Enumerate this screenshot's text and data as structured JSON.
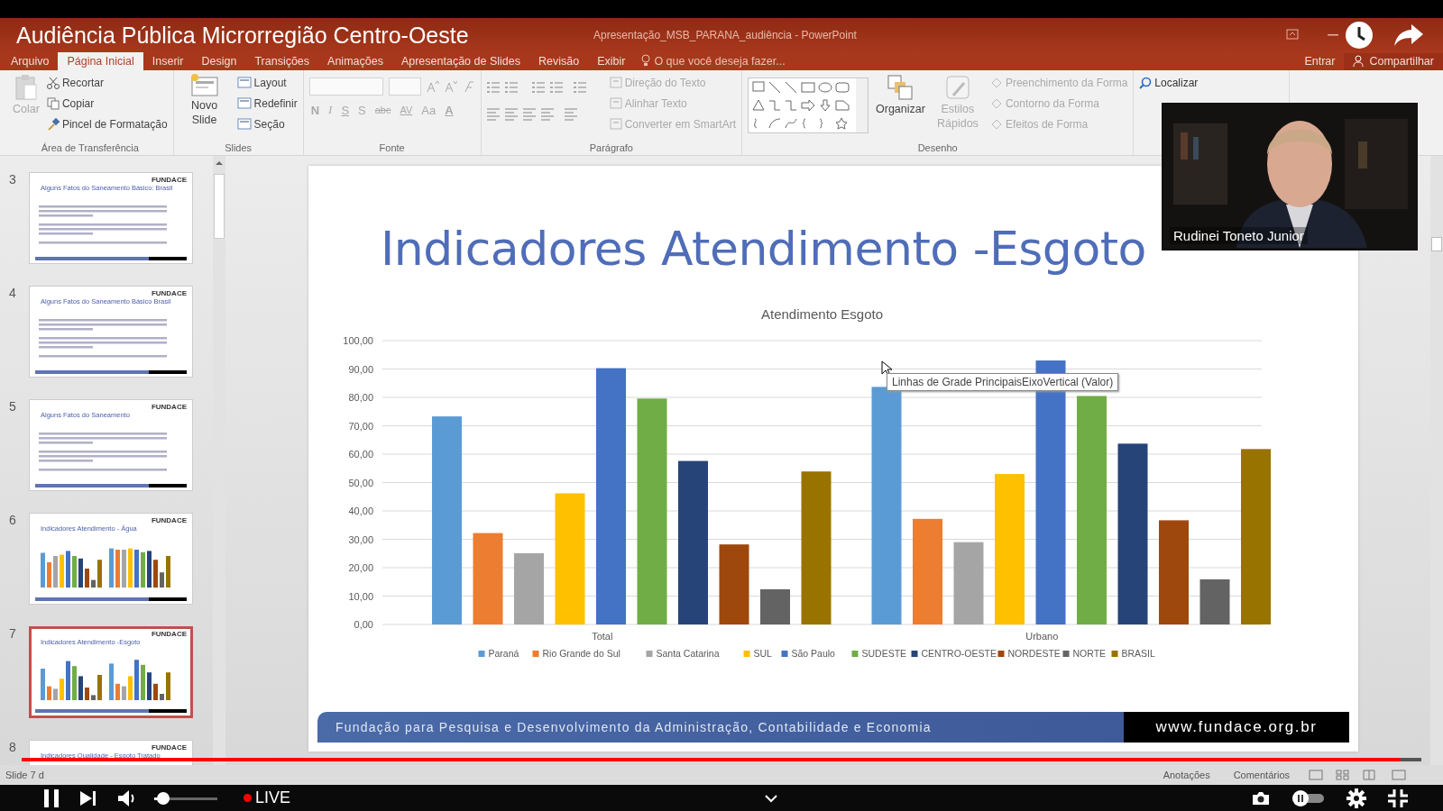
{
  "overlay": {
    "title": "Audiência Pública Microrregião Centro-Oeste"
  },
  "window": {
    "title": "Apresentação_MSB_PARANA_audiência - PowerPoint"
  },
  "menu_tabs": [
    {
      "label": "Arquivo",
      "selected": false
    },
    {
      "label": "Página Inicial",
      "selected": true
    },
    {
      "label": "Inserir",
      "selected": false
    },
    {
      "label": "Design",
      "selected": false
    },
    {
      "label": "Transições",
      "selected": false
    },
    {
      "label": "Animações",
      "selected": false
    },
    {
      "label": "Apresentação de Slides",
      "selected": false
    },
    {
      "label": "Revisão",
      "selected": false
    },
    {
      "label": "Exibir",
      "selected": false
    }
  ],
  "search_hint": "O que você deseja fazer...",
  "account": {
    "sign_in": "Entrar",
    "share": "Compartilhar"
  },
  "ribbon": {
    "clipboard": {
      "label": "Área de Transferência",
      "paste": {
        "label": "Colar",
        "disabled": true
      },
      "items": [
        {
          "label": "Recortar",
          "disabled": false
        },
        {
          "label": "Copiar",
          "disabled": false
        },
        {
          "label": "Pincel de Formatação",
          "disabled": false
        }
      ]
    },
    "slides": {
      "label": "Slides",
      "new_slide": "Novo Slide",
      "items": [
        {
          "label": "Layout",
          "disabled": false
        },
        {
          "label": "Redefinir",
          "disabled": false
        },
        {
          "label": "Seção",
          "disabled": false
        }
      ]
    },
    "font": {
      "label": "Fonte",
      "buttons": [
        "N",
        "I",
        "S",
        "S",
        "abc",
        "AV",
        "Aa",
        "A"
      ]
    },
    "paragraph": {
      "label": "Parágrafo",
      "items": [
        {
          "label": "Direção do Texto",
          "disabled": true
        },
        {
          "label": "Alinhar Texto",
          "disabled": true
        },
        {
          "label": "Converter em SmartArt",
          "disabled": true
        }
      ]
    },
    "drawing": {
      "label": "Desenho",
      "arrange": "Organizar",
      "quick_styles": {
        "label": "Estilos Rápidos",
        "disabled": true
      },
      "items": [
        {
          "label": "Preenchimento da Forma",
          "disabled": true
        },
        {
          "label": "Contorno da Forma",
          "disabled": true
        },
        {
          "label": "Efeitos de Forma",
          "disabled": true
        }
      ]
    },
    "editing": {
      "find": "Localizar"
    }
  },
  "thumbnails": [
    {
      "number": "3",
      "title": "Alguns Fatos do Saneamento Básico: Brasil",
      "logo": "FUNDACE",
      "kind": "text",
      "selected": false
    },
    {
      "number": "4",
      "title": "Alguns Fatos do Saneamento Básico Brasil",
      "logo": "FUNDACE",
      "kind": "text",
      "selected": false
    },
    {
      "number": "5",
      "title": "Alguns Fatos do Saneamento",
      "logo": "FUNDACE",
      "kind": "text",
      "selected": false
    },
    {
      "number": "6",
      "title": "Indicadores Atendimento - Água",
      "logo": "FUNDACE",
      "kind": "chart",
      "selected": false
    },
    {
      "number": "7",
      "title": "Indicadores Atendimento -Esgoto",
      "logo": "FUNDACE",
      "kind": "chart",
      "selected": true
    },
    {
      "number": "8",
      "title": "Indicadores Qualidade - Esgoto Tratado",
      "logo": "FUNDACE",
      "kind": "partial",
      "selected": false
    }
  ],
  "slide": {
    "title": "Indicadores Atendimento -Esgoto",
    "chart_data": {
      "type": "bar",
      "title": "Atendimento Esgoto",
      "categories": [
        "Total",
        "Urbano"
      ],
      "ylim": [
        0,
        100
      ],
      "grid": true,
      "legend": true,
      "yticks": [
        {
          "value": 0,
          "label": "0,00"
        },
        {
          "value": 10,
          "label": "10,00"
        },
        {
          "value": 20,
          "label": "20,00"
        },
        {
          "value": 30,
          "label": "30,00"
        },
        {
          "value": 40,
          "label": "40,00"
        },
        {
          "value": 50,
          "label": "50,00"
        },
        {
          "value": 60,
          "label": "60,00"
        },
        {
          "value": 70,
          "label": "70,00"
        },
        {
          "value": 80,
          "label": "80,00"
        },
        {
          "value": 90,
          "label": "90,00"
        },
        {
          "value": 100,
          "label": "100,00"
        }
      ],
      "series": [
        {
          "name": "Paraná",
          "color": "#5b9bd5",
          "values": [
            73.3,
            83.7
          ]
        },
        {
          "name": "Rio Grande do Sul",
          "color": "#ed7d31",
          "values": [
            32.2,
            37.2
          ]
        },
        {
          "name": "Santa Catarina",
          "color": "#a5a5a5",
          "values": [
            25.1,
            29.0
          ]
        },
        {
          "name": "SUL",
          "color": "#ffc000",
          "values": [
            46.2,
            53.0
          ]
        },
        {
          "name": "São Paulo",
          "color": "#4472c4",
          "values": [
            90.3,
            93.0
          ]
        },
        {
          "name": "SUDESTE",
          "color": "#70ad47",
          "values": [
            79.6,
            80.5
          ]
        },
        {
          "name": "CENTRO-OESTE",
          "color": "#264478",
          "values": [
            57.6,
            63.7
          ]
        },
        {
          "name": "NORDESTE",
          "color": "#9e480e",
          "values": [
            28.2,
            36.7
          ]
        },
        {
          "name": "NORTE",
          "color": "#636363",
          "values": [
            12.4,
            15.9
          ]
        },
        {
          "name": "BRASIL",
          "color": "#997300",
          "values": [
            53.9,
            61.8
          ]
        }
      ]
    },
    "tooltip": "Linhas de Grade PrincipaisEixoVertical (Valor)",
    "footer": {
      "text": "Fundação para Pesquisa e Desenvolvimento da Administração, Contabilidade e Economia",
      "url": "www.fundace.org.br"
    }
  },
  "webcam": {
    "name": "Rudinei Toneto Junior"
  },
  "status_bar": {
    "slide_info": "Slide 7 d",
    "notes": "Anotações",
    "comments": "Comentários"
  },
  "player": {
    "live": "LIVE",
    "progress": {
      "level": 0.985
    },
    "volume": {
      "level": 0.12
    }
  }
}
